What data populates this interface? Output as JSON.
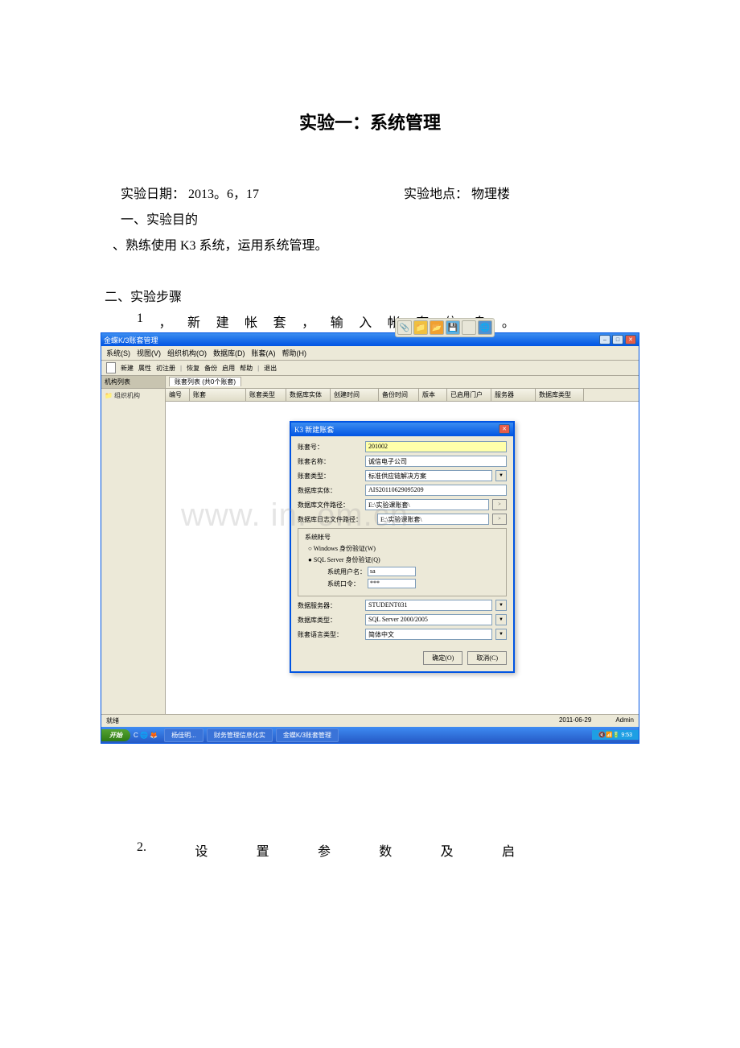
{
  "doc": {
    "title": "实验一：系统管理",
    "date_label": "实验日期：",
    "date_value": "2013。6，17",
    "location_label": "实验地点：",
    "location_value": "物理楼",
    "section1": "一、实验目的",
    "bullet1": "、熟练使用 K3 系统，运用系统管理。",
    "section2": "二、实验步骤",
    "step1_num": "1",
    "step1_sep": "，",
    "step1_c1": "新",
    "step1_c2": "建",
    "step1_c3": "帐",
    "step1_c4": "套",
    "step1_c5": "，",
    "step1_c6": "输",
    "step1_c7": "入",
    "step1_c8": "帐",
    "step1_c9": "套",
    "step1_c10": "信",
    "step1_c11": "息",
    "step1_c12": "。",
    "step2_num": "2.",
    "step2_c1": "设",
    "step2_c2": "置",
    "step2_c3": "参",
    "step2_c4": "数",
    "step2_c5": "及",
    "step2_c6": "启"
  },
  "app": {
    "window_title": "金蝶K/3账套管理",
    "menu": {
      "system": "系统(S)",
      "view": "视图(V)",
      "org": "组织机构(O)",
      "db": "数据库(D)",
      "acct": "账套(A)",
      "help": "帮助(H)"
    },
    "toolbar": {
      "new": "新建",
      "prop": "属性",
      "reg": "初注册",
      "refresh": "恢复",
      "backup": "备份",
      "user": "启用",
      "upgrade": "帮助",
      "exit": "退出"
    },
    "sidebar": {
      "head": "机构列表",
      "item": "组织机构"
    },
    "tab": "账套列表 (共0个账套)",
    "grid": {
      "c1": "编号",
      "c2": "账套",
      "c3": "账套类型",
      "c4": "数据库实体",
      "c5": "创建时间",
      "c6": "备份时间",
      "c7": "版本",
      "c8": "已启用门户",
      "c9": "服务器",
      "c10": "数据库类型"
    },
    "status": {
      "ready": "就绪",
      "date": "2011-06-29",
      "user": "Admin"
    },
    "taskbar": {
      "start": "开始",
      "item1": "杨佳明...",
      "item2": "财务管理信息化实",
      "item3": "金蝶K/3账套管理",
      "tray": "9:53"
    }
  },
  "dialog": {
    "title": "新建账套",
    "acct_no_label": "账套号：",
    "acct_no": "201002",
    "acct_name_label": "账套名称：",
    "acct_name": "诚信电子公司",
    "acct_type_label": "账套类型：",
    "acct_type": "标准供应链解决方案",
    "db_entity_label": "数据库实体：",
    "db_entity": "AIS20110629095209",
    "db_path_label": "数据库文件路径：",
    "db_path": "E:\\实验课账套\\",
    "log_path_label": "数据库日志文件路径：",
    "log_path": "E:\\实验课账套\\",
    "fieldset_legend": "系统帐号",
    "radio1": "Windows 身份验证(W)",
    "radio2": "SQL Server 身份验证(Q)",
    "sys_user_label": "系统用户名：",
    "sys_user": "sa",
    "sys_pwd_label": "系统口令：",
    "sys_pwd": "***",
    "db_server_label": "数据服务器：",
    "db_server": "STUDENT031",
    "db_type_label": "数据库类型：",
    "db_type": "SQL Server 2000/2005",
    "lang_label": "账套语言类型：",
    "lang": "简体中文",
    "ok": "确定(O)",
    "cancel": "取消(C)"
  },
  "watermark": "www.      in.  om.cn"
}
